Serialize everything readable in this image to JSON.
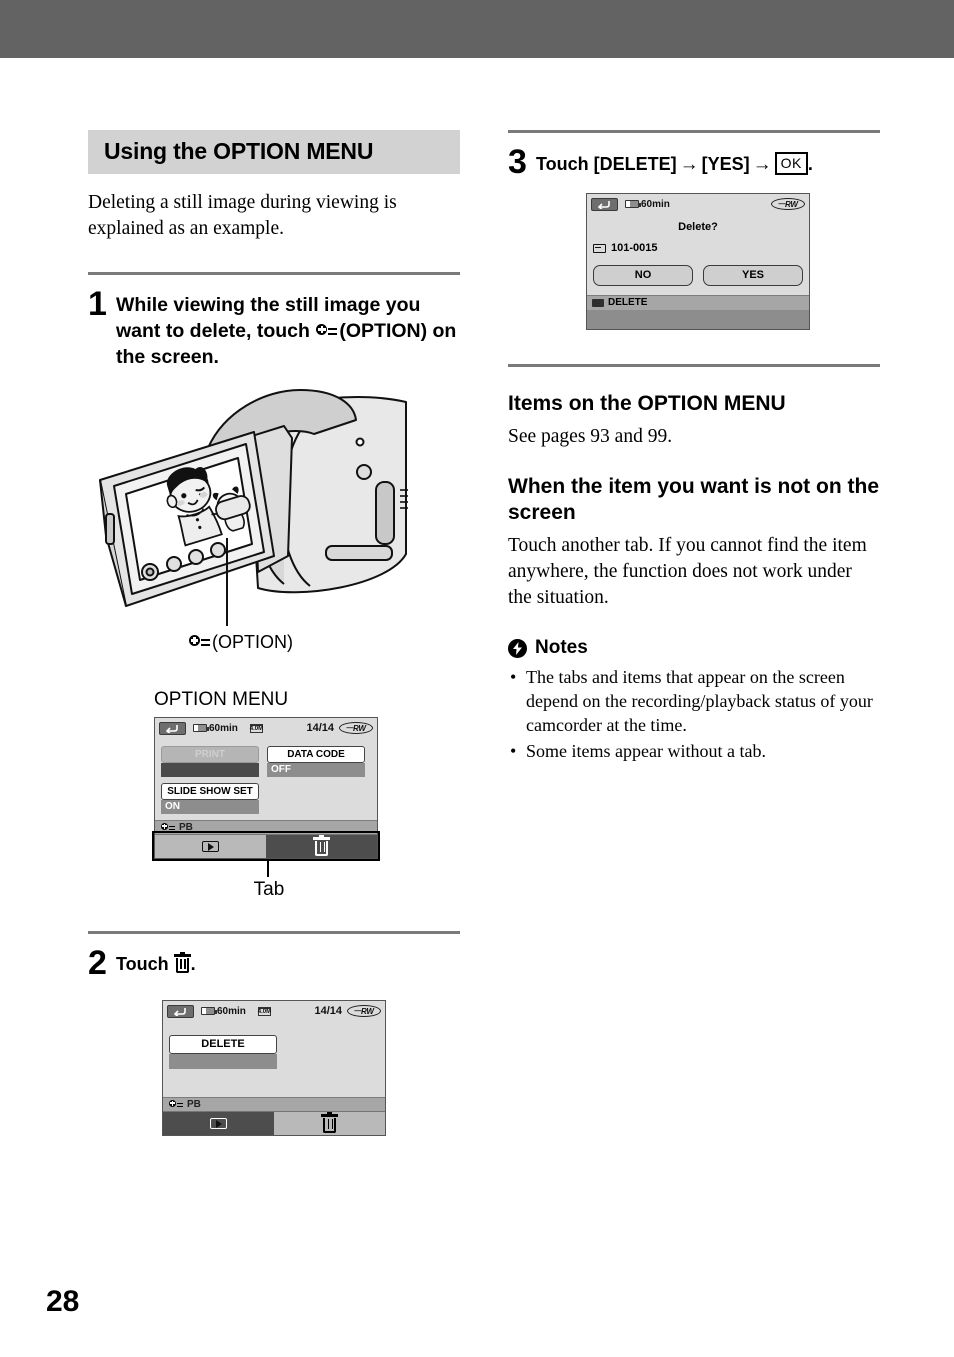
{
  "page": {
    "number": "28"
  },
  "left": {
    "section_title": "Using the OPTION MENU",
    "intro": "Deleting a still image during viewing is explained as an example.",
    "step1": {
      "number": "1",
      "text_before": "While viewing the still image you want to delete, touch",
      "icon": "option-icon",
      "text_after": "(OPTION) on the screen."
    },
    "camcorder_caption": "(OPTION)",
    "option_menu_label": "OPTION MENU",
    "tab_label": "Tab",
    "step2": {
      "number": "2",
      "text_before": "Touch",
      "icon": "trash-icon",
      "text_after": "."
    }
  },
  "right": {
    "step3": {
      "number": "3",
      "part1": "Touch [DELETE]",
      "arrow1": "→",
      "part2": "[YES]",
      "arrow2": "→",
      "okkey": "OK",
      "period": "."
    },
    "items_heading": "Items on the OPTION MENU",
    "items_body": "See pages 93 and 99.",
    "notfound_heading": "When the item you want is not on the screen",
    "notfound_body": "Touch another tab. If you cannot find the item anywhere, the function does not work under the situation.",
    "notes_title": "Notes",
    "notes_badge": "⚡",
    "notes": [
      "The tabs and items that appear on the screen depend on the recording/playback status of your camcorder at the time.",
      "Some items appear without a tab."
    ]
  },
  "screens": {
    "option_menu": {
      "status": {
        "return": "↵",
        "battery": "60min",
        "image_size": "4.0M",
        "counter": "14/14",
        "disc": "RW"
      },
      "items": [
        {
          "label": "PRINT",
          "value": "",
          "disabled": true
        },
        {
          "label": "DATA CODE",
          "value": "OFF",
          "disabled": false
        },
        {
          "label": "SLIDE SHOW SET",
          "value": "ON",
          "disabled": false
        }
      ],
      "strip_label": "PB",
      "tabs": [
        {
          "icon": "playback-icon",
          "selected": true
        },
        {
          "icon": "trash-icon",
          "selected": false
        }
      ]
    },
    "delete_menu": {
      "status": {
        "return": "↵",
        "battery": "60min",
        "image_size": "4.0M",
        "counter": "14/14",
        "disc": "RW"
      },
      "button": "DELETE",
      "strip_label": "PB",
      "tabs": [
        {
          "icon": "playback-icon",
          "selected": false
        },
        {
          "icon": "trash-icon",
          "selected": true
        }
      ]
    },
    "confirm": {
      "status": {
        "return": "↵",
        "battery": "60min",
        "disc": "RW"
      },
      "question": "Delete?",
      "file": "101-0015",
      "no_label": "NO",
      "yes_label": "YES",
      "strip_label": "DELETE"
    }
  },
  "colors": {
    "top_band": "#636363",
    "title_bar": "#d2d2d2",
    "rule": "#7a7a7a"
  }
}
